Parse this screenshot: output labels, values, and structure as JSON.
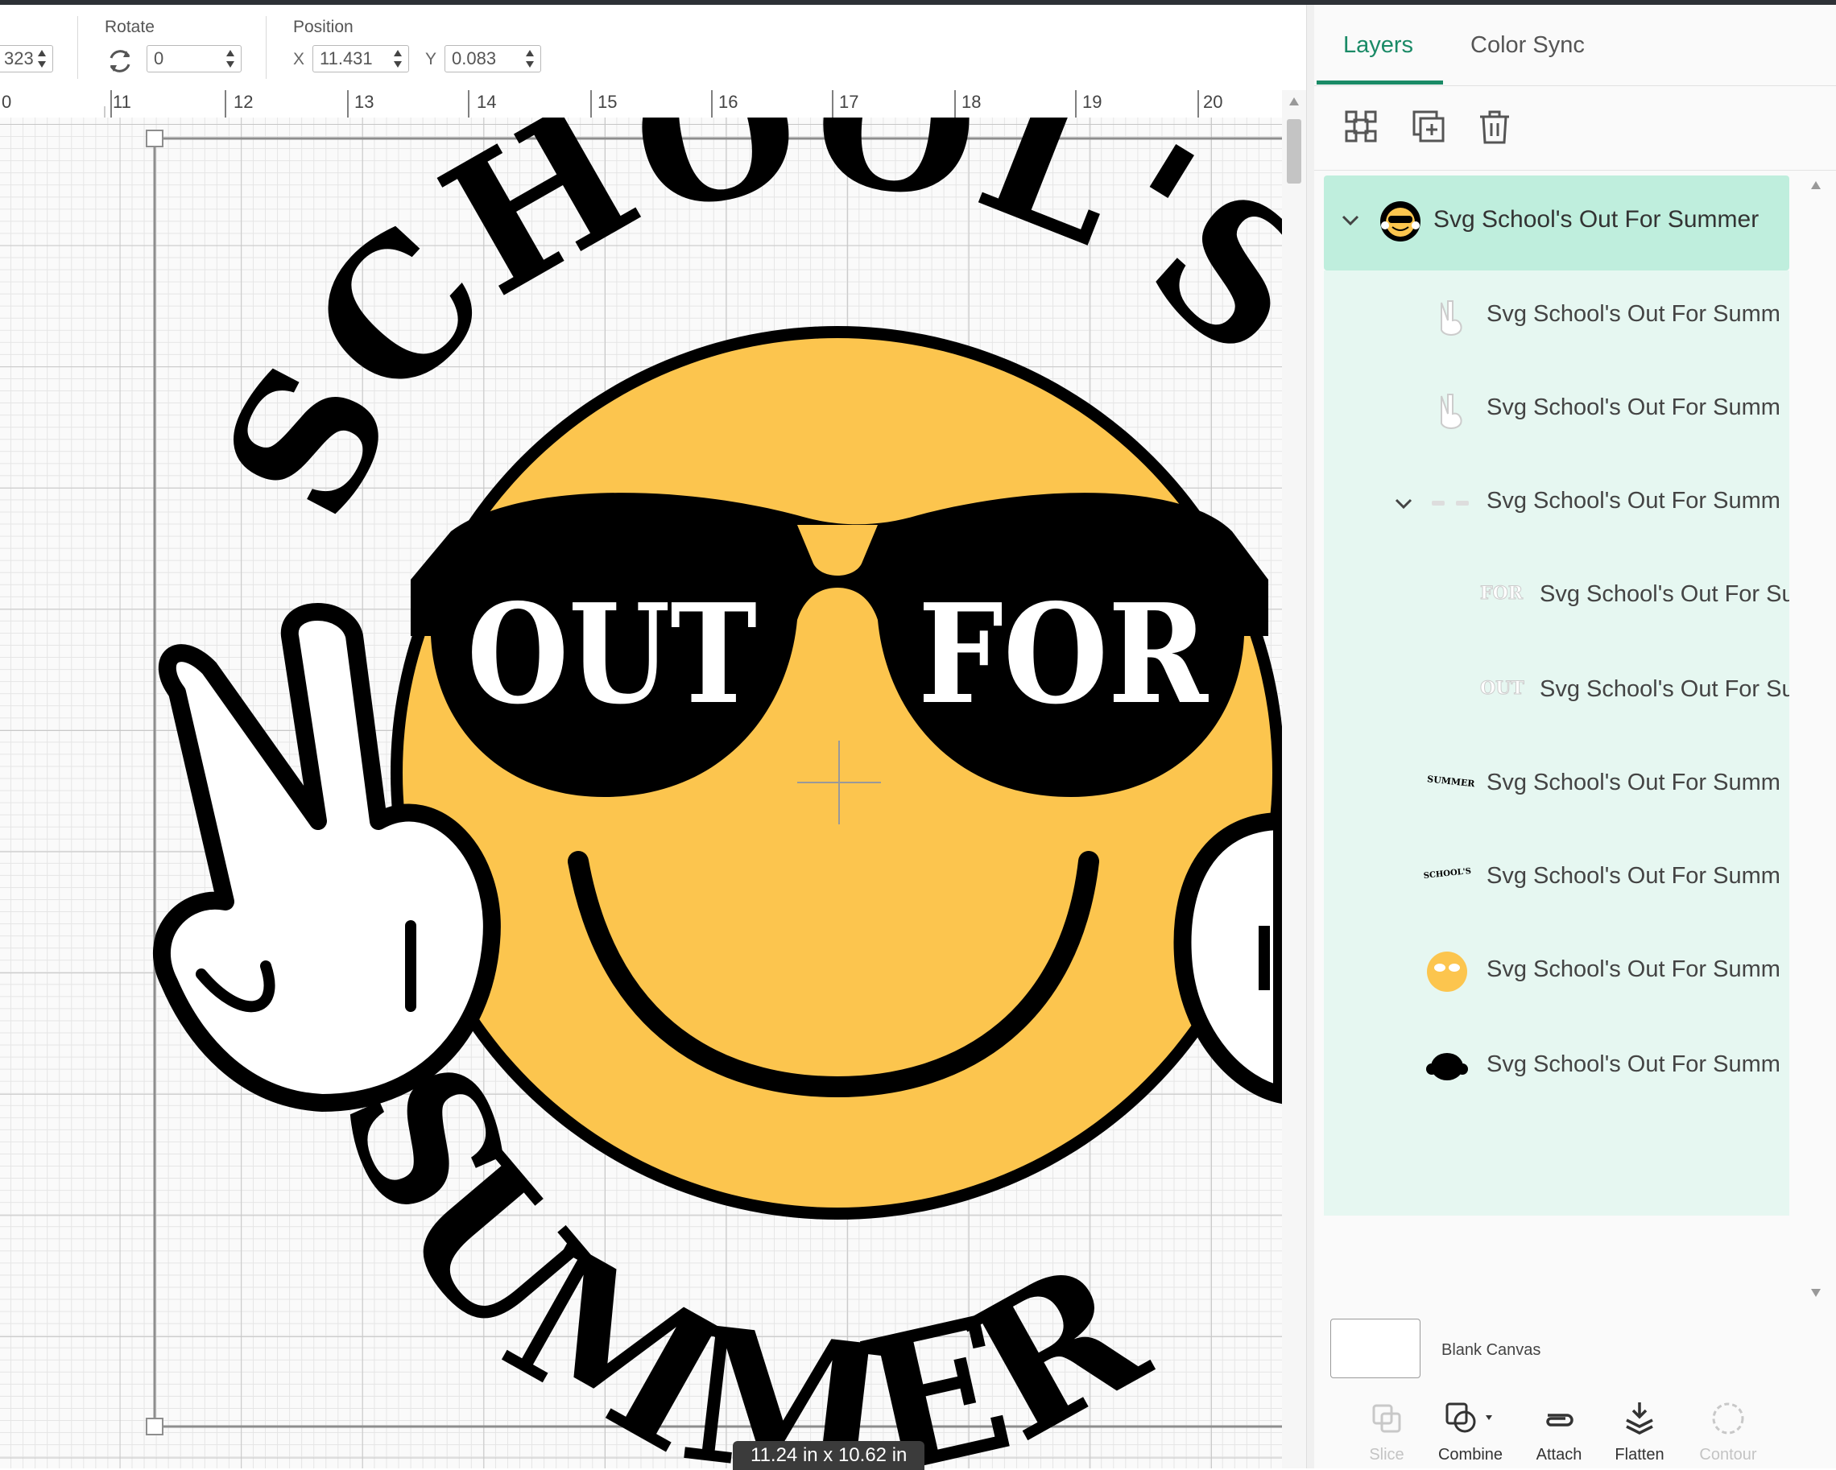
{
  "toolbar": {
    "size_partial_value": "323",
    "rotate_label": "Rotate",
    "rotate_value": "0",
    "position_label": "Position",
    "x_label": "X",
    "x_value": "11.431",
    "y_label": "Y",
    "y_value": "0.083"
  },
  "ruler": {
    "numbers": [
      "0",
      "11",
      "12",
      "13",
      "14",
      "15",
      "16",
      "17",
      "18",
      "19",
      "20"
    ]
  },
  "canvas": {
    "artwork": {
      "top_text": "SCHOOL'S",
      "lens_left_text": "OUT",
      "lens_right_text": "FOR",
      "bottom_text": "SUMMER"
    },
    "size_badge": "11.24  in x 10.62  in"
  },
  "panel": {
    "tabs": [
      {
        "label": "Layers",
        "active": true
      },
      {
        "label": "Color Sync",
        "active": false
      }
    ],
    "action_icons": [
      "group-icon",
      "duplicate-icon",
      "delete-icon"
    ],
    "group_name": "Svg School's Out For Summer",
    "layers": [
      {
        "name": "Svg School's Out For Summ",
        "thumb": "peace-hand"
      },
      {
        "name": "Svg School's Out For Summ",
        "thumb": "peace-hand"
      },
      {
        "name": "Svg School's Out For Summ",
        "thumb": "glasses-group"
      },
      {
        "name": "Svg School's Out For Su",
        "thumb": "for-text",
        "thumb_text": "FOR"
      },
      {
        "name": "Svg School's Out For Su",
        "thumb": "out-text",
        "thumb_text": "OUT"
      },
      {
        "name": "Svg School's Out For Summ",
        "thumb": "summer-text",
        "thumb_text": "SUMMER"
      },
      {
        "name": "Svg School's Out For Summ",
        "thumb": "schools-text",
        "thumb_text": "SCHOOL'S"
      },
      {
        "name": "Svg School's Out For Summ",
        "thumb": "face-yellow"
      },
      {
        "name": "Svg School's Out For Summ",
        "thumb": "black-shape"
      }
    ],
    "blank_canvas_label": "Blank Canvas",
    "bottom_actions": [
      {
        "label": "Slice",
        "enabled": false
      },
      {
        "label": "Combine",
        "enabled": true
      },
      {
        "label": "Attach",
        "enabled": true
      },
      {
        "label": "Flatten",
        "enabled": true
      },
      {
        "label": "Contour",
        "enabled": false
      }
    ]
  },
  "colors": {
    "accent": "#1a8a66",
    "selected_group": "#bfeedd",
    "selected_child": "#e6f7f1",
    "face_yellow": "#fcc54e"
  }
}
